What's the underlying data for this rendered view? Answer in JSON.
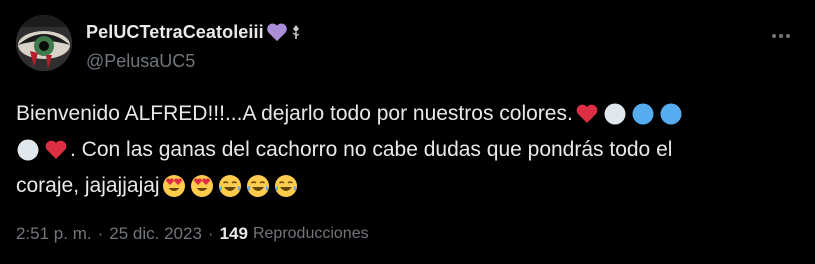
{
  "author": {
    "display_name": "PelUCTetraCeatoleiii",
    "handle": "@PelusaUC5",
    "avatar_icon": "eye-avatar-icon",
    "name_emojis": [
      "purple-heart-icon",
      "rose-icon"
    ]
  },
  "menu": {
    "more_icon": "more-dots-icon"
  },
  "tweet": {
    "line1_text": "Bienvenido ALFRED!!!...A dejarlo todo por nuestros colores.",
    "line1_emojis": [
      "red-heart-icon",
      "white-circle-icon",
      "blue-circle-icon",
      "blue-circle-icon"
    ],
    "line2_emojis": [
      "white-circle-icon",
      "red-heart-icon"
    ],
    "line2_text": ". Con las ganas del cachorro no cabe dudas que pondrás todo el",
    "line3_text": "coraje, jajajjajaj",
    "line3_emojis": [
      "heart-eyes-icon",
      "heart-eyes-icon",
      "tears-of-joy-icon",
      "tears-of-joy-icon",
      "tears-of-joy-icon"
    ]
  },
  "meta": {
    "time": "2:51 p. m.",
    "separator": "·",
    "date": "25 dic. 2023",
    "views_count": "149",
    "views_label": "Reproducciones"
  },
  "colors": {
    "background": "#000000",
    "primary_text": "#e7e9ea",
    "secondary_text": "#71767b",
    "heart_red": "#dd2e44",
    "circle_white": "#e1e8ed",
    "circle_blue": "#55acee",
    "purple_heart": "#aa8ed6",
    "emoji_yellow": "#ffcc4d"
  }
}
